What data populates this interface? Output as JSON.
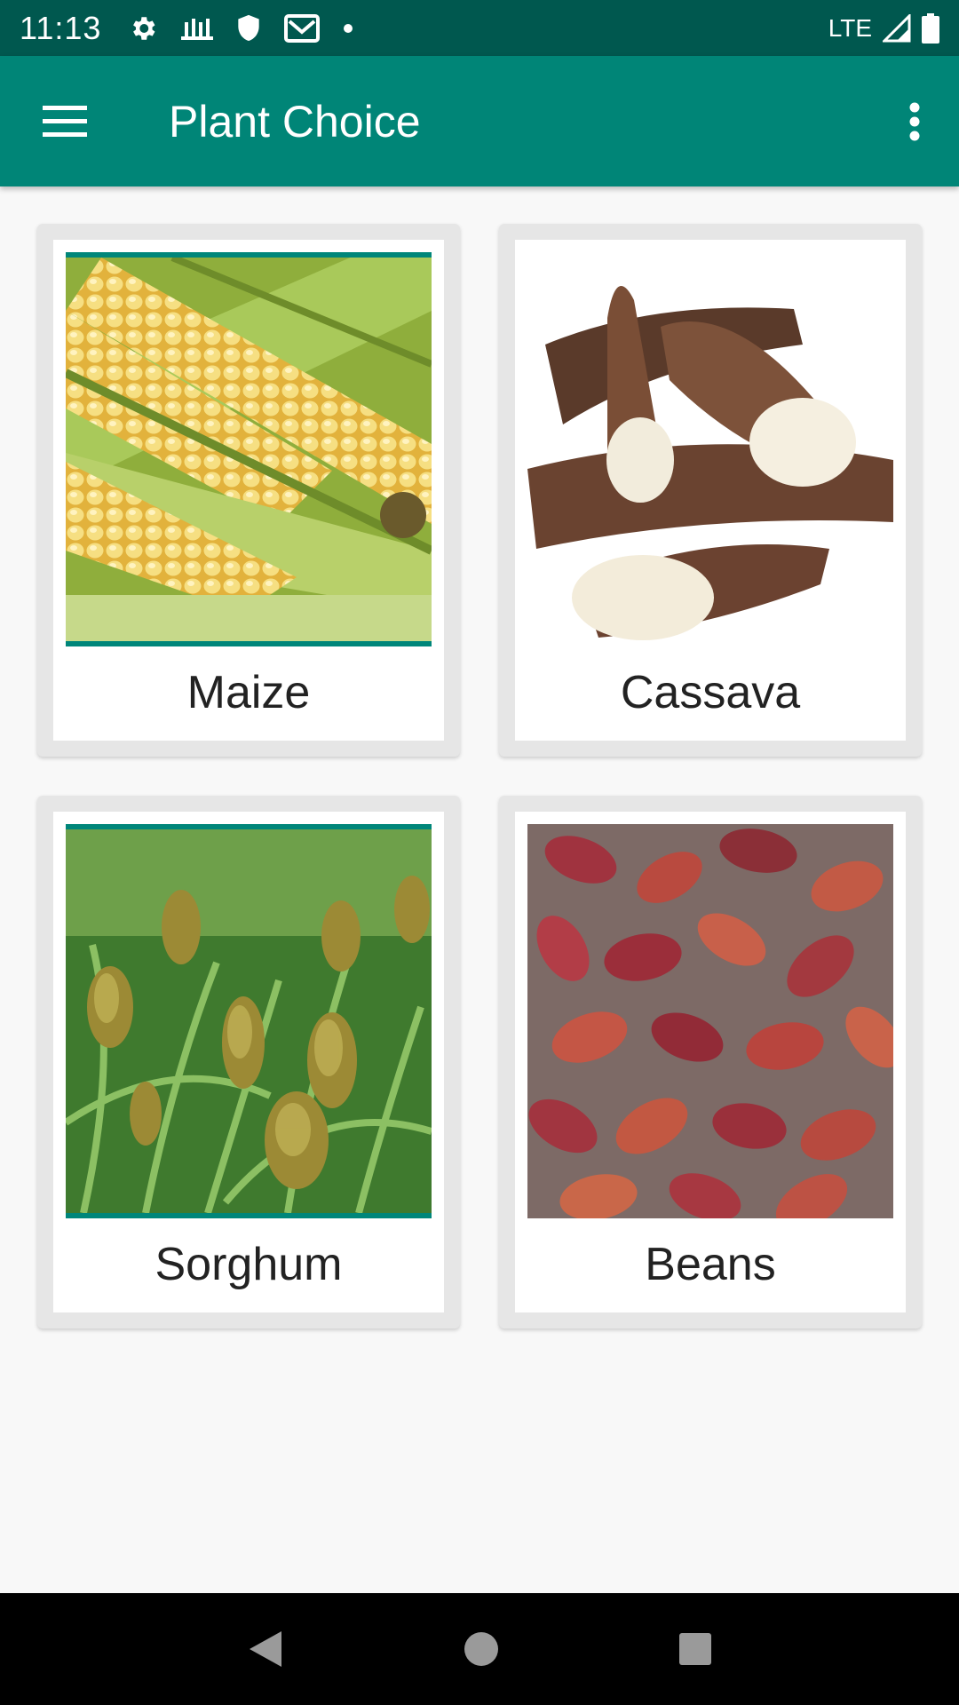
{
  "status_bar": {
    "time": "11:13",
    "network": "LTE",
    "icons": [
      "gear-icon",
      "farm-icon",
      "shield-icon",
      "gmail-icon",
      "dot-icon",
      "signal-icon",
      "battery-icon"
    ]
  },
  "app_bar": {
    "title": "Plant Choice",
    "color": "#008577",
    "status_color": "#00584f",
    "icons": [
      "menu-icon",
      "overflow-icon"
    ]
  },
  "plants": [
    {
      "label": "Maize"
    },
    {
      "label": "Cassava"
    },
    {
      "label": "Sorghum"
    },
    {
      "label": "Beans"
    }
  ],
  "nav_bar": {
    "icons": [
      "back-icon",
      "home-icon",
      "recents-icon"
    ]
  },
  "colors": {
    "accent": "#008577",
    "card_bg": "#e6e6e6"
  }
}
